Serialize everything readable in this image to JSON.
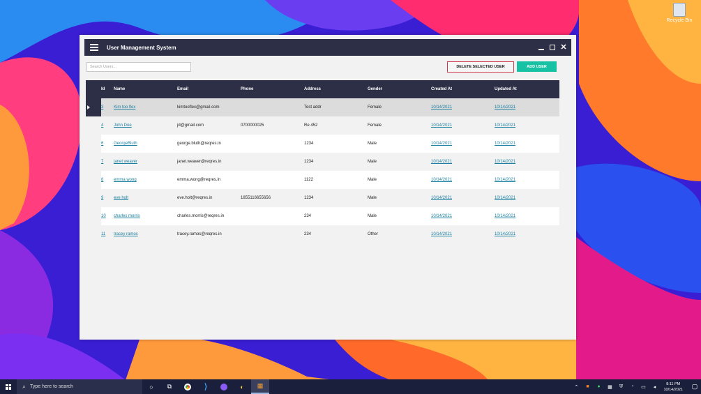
{
  "desktop": {
    "recycle_bin_label": "Recycle Bin"
  },
  "window": {
    "title": "User Management System",
    "search_placeholder": "Search Users...",
    "delete_button": "DELETE SELECTED USER",
    "add_button": "ADD USER"
  },
  "table": {
    "columns": [
      "Id",
      "Name",
      "Email",
      "Phone",
      "Address",
      "Gender",
      "Created At",
      "Updated At"
    ],
    "rows": [
      [
        "3",
        "Kim too flex",
        "kimtooflex@gmail.com",
        "",
        "Test addr",
        "Female",
        "10/14/2021",
        "10/14/2021"
      ],
      [
        "4",
        "John Doe",
        "jd@gmail.com",
        "0700000025",
        "Re 452",
        "Female",
        "10/14/2021",
        "10/14/2021"
      ],
      [
        "6",
        "GeorgeBluth",
        "george.bluth@reqres.in",
        "",
        "1234",
        "Male",
        "10/14/2021",
        "10/14/2021"
      ],
      [
        "7",
        "janet weaver ",
        "janet.weaver@reqres.in",
        "",
        "1234",
        "Male",
        "10/14/2021",
        "10/14/2021"
      ],
      [
        "8",
        "emma wong ",
        "emma.wong@reqres.in",
        "",
        "1122",
        "Male",
        "10/14/2021",
        "10/14/2021"
      ],
      [
        "9",
        "eve holt ",
        "eve.holt@reqres.in",
        "1855116655656",
        "1234",
        "Male",
        "10/14/2021",
        "10/14/2021"
      ],
      [
        "10",
        "charles morris ",
        "charles.morris@reqres.in",
        "",
        "234",
        "Male",
        "10/14/2021",
        "10/14/2021"
      ],
      [
        "11",
        "tracey ramos ",
        "tracey.ramos@reqres.in",
        "",
        "234",
        "Other",
        "10/14/2021",
        "10/14/2021"
      ]
    ],
    "selected_row_index": 0
  },
  "taskbar": {
    "search_placeholder": "Type here to search",
    "time": "8:11 PM",
    "date": "10/14/2021",
    "icons": [
      "cortana-icon",
      "task-view-icon",
      "chrome-icon",
      "vscode-icon",
      "github-desktop-icon",
      "unknown-app-icon",
      "winforms-app-icon"
    ]
  },
  "colors": {
    "titlebar": "#2c2f45",
    "add_button": "#16c2a3",
    "delete_border": "#d0374b",
    "link": "#1a7fa0"
  }
}
